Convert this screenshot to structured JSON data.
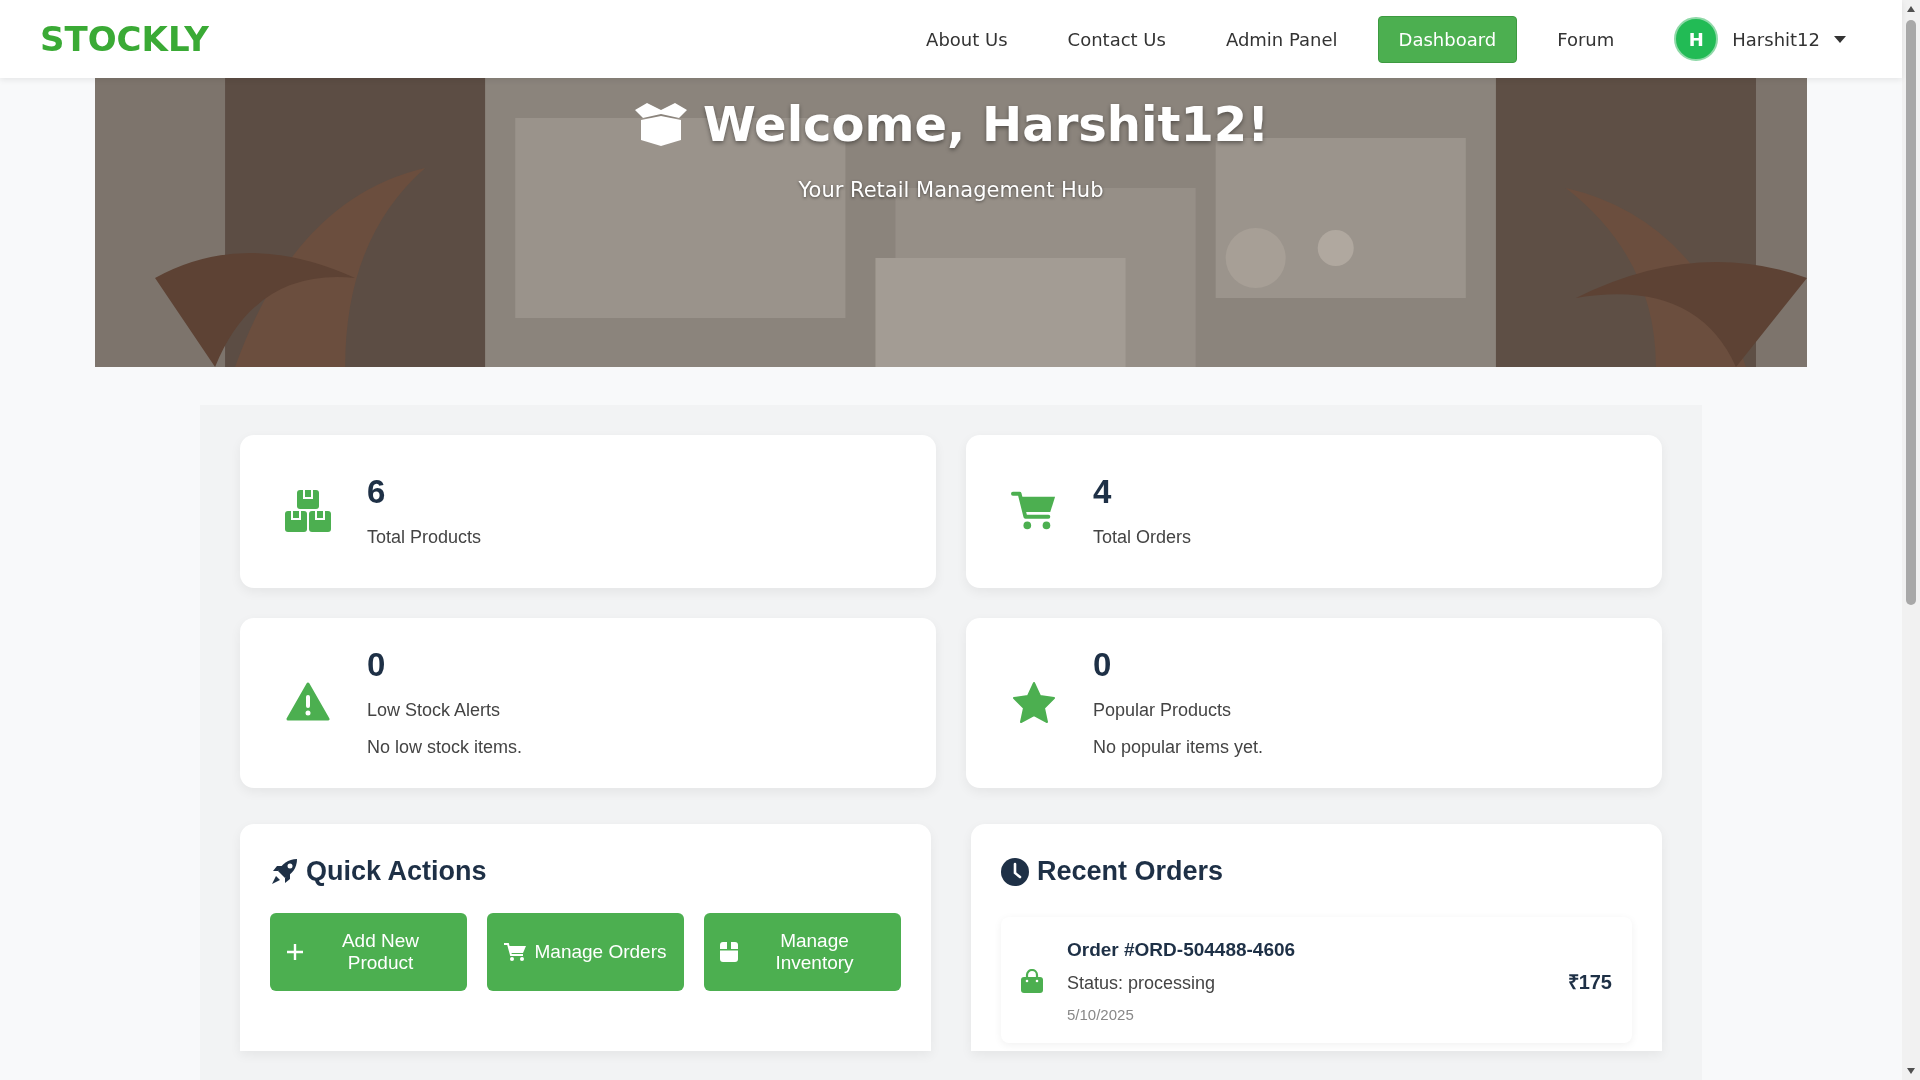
{
  "nav": {
    "logo": "STOCKLY",
    "links": [
      {
        "label": "About Us",
        "selected": false
      },
      {
        "label": "Contact Us",
        "selected": false
      },
      {
        "label": "Admin Panel",
        "selected": false
      },
      {
        "label": "Dashboard",
        "selected": true
      },
      {
        "label": "Forum",
        "selected": false
      }
    ],
    "user": {
      "initial": "H",
      "name": "Harshit12"
    }
  },
  "hero": {
    "title": "Welcome, Harshit12!",
    "subtitle": "Your Retail Management Hub"
  },
  "stats": [
    {
      "kind": "boxes",
      "value": "6",
      "label": "Total Products"
    },
    {
      "kind": "cart",
      "value": "4",
      "label": "Total Orders"
    },
    {
      "kind": "warning",
      "value": "0",
      "label": "Low Stock Alerts",
      "note": "No low stock items."
    },
    {
      "kind": "star",
      "value": "0",
      "label": "Popular Products",
      "note": "No popular items yet."
    }
  ],
  "quick_actions": {
    "title": "Quick Actions",
    "buttons": [
      {
        "kind": "plus",
        "label": "Add New Product"
      },
      {
        "kind": "cart",
        "label": "Manage Orders"
      },
      {
        "kind": "box",
        "label": "Manage Inventory"
      }
    ]
  },
  "recent_orders": {
    "title": "Recent Orders",
    "orders": [
      {
        "title": "Order #ORD-504488-4606",
        "status": "Status: processing",
        "date": "5/10/2025",
        "amount": "₹175"
      }
    ]
  }
}
